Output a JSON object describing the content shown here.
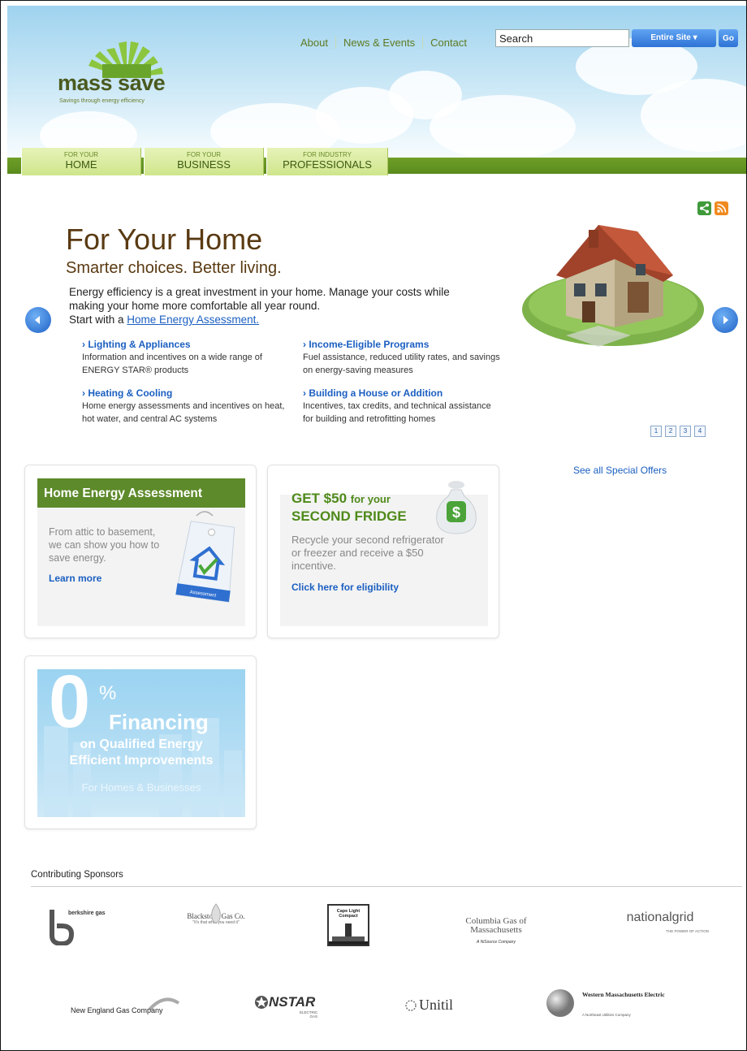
{
  "header": {
    "logo_text": "mass save",
    "logo_tagline": "Savings through energy efficiency",
    "nav": [
      "About",
      "News & Events",
      "Contact"
    ],
    "search_value": "Search",
    "scope_label": "Entire Site ▾",
    "go_label": "Go"
  },
  "tabs": [
    {
      "small": "FOR YOUR",
      "big": "HOME"
    },
    {
      "small": "FOR YOUR",
      "big": "BUSINESS"
    },
    {
      "small": "FOR INDUSTRY",
      "big": "PROFESSIONALS"
    }
  ],
  "hero": {
    "title": "For Your Home",
    "subtitle": "Smarter choices. Better living.",
    "desc_1": "Energy efficiency is a great investment in your home. Manage your costs while making your home more comfortable all year round.",
    "desc_start": "Start with a",
    "desc_link": "Home Energy Assessment.",
    "features": [
      {
        "title": "› Lighting & Appliances",
        "text": "Information and incentives on a wide range of ENERGY STAR® products"
      },
      {
        "title": "› Income-Eligible Programs",
        "text": "Fuel assistance, reduced utility rates, and savings on energy-saving measures"
      },
      {
        "title": "› Heating & Cooling",
        "text": "Home energy assessments and incentives on heat, hot water, and central AC systems"
      },
      {
        "title": "› Building a House or Addition",
        "text": "Incentives, tax credits, and technical assistance for building and retrofitting homes"
      }
    ],
    "pages": [
      "1",
      "2",
      "3",
      "4"
    ],
    "offers_link": "See all Special Offers"
  },
  "cards": {
    "hea": {
      "title": "Home Energy Assessment",
      "text": "From attic to basement, we can show you how to save energy.",
      "link": "Learn more",
      "tag_label": "Assessment"
    },
    "fridge": {
      "title_1": "GET $50",
      "title_1b": "for your",
      "title_2": "SECOND FRIDGE",
      "text": "Recycle your second refrigerator or freezer and receive a $50 incentive.",
      "link": "Click here for eligibility",
      "bag_symbol": "$"
    },
    "financing": {
      "zero": "0",
      "pct": "%",
      "line1": "Financing",
      "line2": "on Qualified Energy",
      "line3": "Efficient Improvements",
      "line4": "For Homes & Businesses"
    }
  },
  "sponsors": {
    "title": "Contributing Sponsors",
    "items": [
      "berkshire gas",
      "Blackstone Gas Co.",
      "Cape Light Compact",
      "Columbia Gas of Massachusetts",
      "nationalgrid",
      "New England Gas Company",
      "NSTAR",
      "Unitil",
      "Western Massachusetts Electric"
    ],
    "blackstone_tag": "\"It's that what you need it\"",
    "columbia_tag": "A NiSource Company",
    "ng_tag": "THE POWER OF ACTION",
    "nstar_tag": "ELECTRIC GAS",
    "wme_tag": "A Northeast Utilities Company"
  }
}
